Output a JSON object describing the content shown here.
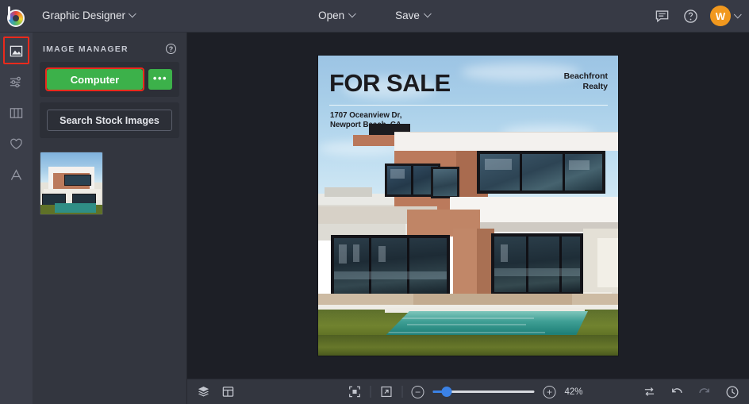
{
  "topbar": {
    "logo_icon": "befunky-logo-icon",
    "app_name": "Graphic Designer",
    "app_name_chevron_icon": "chevron-down-icon",
    "open_label": "Open",
    "save_label": "Save",
    "feedback_icon": "chat-bubble-icon",
    "help_icon": "question-circle-icon",
    "avatar_initial": "W",
    "avatar_chevron_icon": "chevron-down-icon",
    "avatar_color": "#f1981e"
  },
  "rail": {
    "items": [
      {
        "name": "image-manager",
        "icon": "image-icon",
        "active": true
      },
      {
        "name": "edit-adjust",
        "icon": "sliders-icon",
        "active": false
      },
      {
        "name": "collage",
        "icon": "columns-icon",
        "active": false
      },
      {
        "name": "favorites",
        "icon": "heart-icon",
        "active": false
      },
      {
        "name": "text",
        "icon": "text-a-icon",
        "active": false
      }
    ],
    "highlight_color": "#ea2a1c"
  },
  "panel": {
    "title": "IMAGE MANAGER",
    "help_icon": "question-circle-icon",
    "help_label": "?",
    "computer_label": "Computer",
    "more_label": "•••",
    "more_icon": "ellipsis-icon",
    "search_stock_label": "Search Stock Images",
    "button_color": "#3cb14a",
    "thumbnail_name": "villa-thumbnail"
  },
  "canvas": {
    "artboard_name": "for-sale-poster",
    "poster": {
      "headline": "FOR SALE",
      "brand_line1": "Beachfront",
      "brand_line2": "Realty",
      "address_line1": "1707 Oceanview Dr,",
      "address_line2": "Newport Beach, CA"
    }
  },
  "bottombar": {
    "layers_icon": "layers-icon",
    "template_icon": "layout-template-icon",
    "fit_screen_icon": "fit-to-screen-icon",
    "fullscreen_icon": "expand-arrow-icon",
    "zoom_out_icon": "minus-icon",
    "zoom_out_label": "−",
    "zoom_in_icon": "plus-icon",
    "zoom_in_label": "+",
    "zoom_level": "42%",
    "compare_icon": "swap-arrows-icon",
    "undo_icon": "undo-arrow-icon",
    "redo_icon": "redo-arrow-icon",
    "history_icon": "history-clock-icon",
    "slider_accent": "#3b82e6"
  }
}
